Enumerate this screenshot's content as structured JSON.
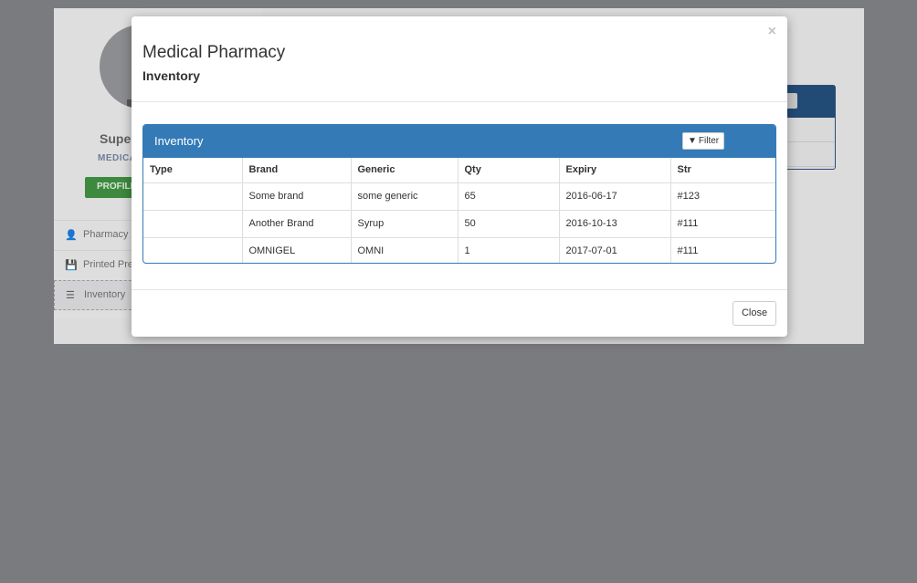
{
  "background": {
    "user_name": "Super",
    "user_sub": "MEDICA",
    "profile_button": "PROFILE",
    "nav_items": [
      {
        "label": "Pharmacy",
        "icon": "user-icon"
      },
      {
        "label": "Printed Pre",
        "icon": "save-icon"
      },
      {
        "label": "Inventory",
        "icon": "list-icon"
      }
    ]
  },
  "modal": {
    "title": "Medical Pharmacy",
    "subtitle": "Inventory",
    "close_symbol": "×",
    "panel_title": "Inventory",
    "filter_label": "Filter",
    "close_button": "Close"
  },
  "table": {
    "columns": [
      "Type",
      "Brand",
      "Generic",
      "Qty",
      "Expiry",
      "Str"
    ],
    "rows": [
      [
        "",
        "Some brand",
        "some generic",
        "65",
        "2016-06-17",
        "#123"
      ],
      [
        "",
        "Another Brand",
        "Syrup",
        "50",
        "2016-10-13",
        "#111"
      ],
      [
        "",
        "OMNIGEL",
        "OMNI",
        "1",
        "2017-07-01",
        "#111"
      ]
    ]
  },
  "colors": {
    "primary": "#337ab7",
    "overlay": "#7a7b7e"
  }
}
